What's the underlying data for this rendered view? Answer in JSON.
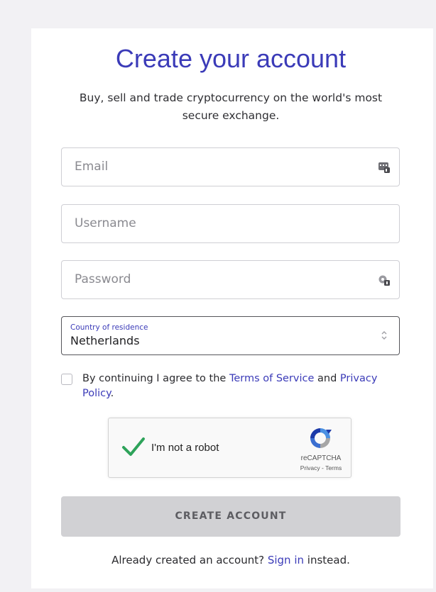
{
  "heading": "Create your account",
  "subheading": "Buy, sell and trade cryptocurrency on the world's most secure exchange.",
  "form": {
    "email_placeholder": "Email",
    "username_placeholder": "Username",
    "password_placeholder": "Password",
    "country_label": "Country of residence",
    "country_value": "Netherlands"
  },
  "consent": {
    "prefix": "By continuing I agree to the ",
    "terms_link": "Terms of Service",
    "middle": " and ",
    "privacy_link": "Privacy Policy",
    "suffix": "."
  },
  "recaptcha": {
    "label": "I'm not a robot",
    "brand": "reCAPTCHA",
    "legal": "Privacy - Terms"
  },
  "create_button": "CREATE ACCOUNT",
  "signin": {
    "prefix": "Already created an account? ",
    "link": "Sign in",
    "suffix": " instead."
  },
  "colors": {
    "accent": "#3b3bb8",
    "button_disabled": "#d1d1d4",
    "check_green": "#2ea35a"
  },
  "icons": {
    "email_autofill": "keyboard-autofill-icon",
    "password_autofill": "password-key-icon",
    "select": "chevron-up-down-icon",
    "check": "checkmark-icon",
    "recaptcha": "recaptcha-logo-icon"
  }
}
